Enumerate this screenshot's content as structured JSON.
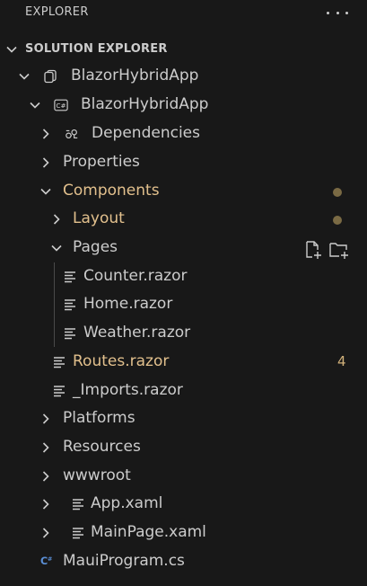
{
  "header": {
    "title": "EXPLORER",
    "more_icon": "ellipsis-icon"
  },
  "section": {
    "title": "SOLUTION EXPLORER",
    "expanded": true
  },
  "colors": {
    "background": "#181818",
    "text": "#cccccc",
    "modified": "#e2c08d",
    "badge": "#d1b17a",
    "csharp_icon": "#5b8fd6"
  },
  "tree": [
    {
      "label": "BlazorHybridApp",
      "chevron": "down",
      "icon": "solution-icon",
      "state": "normal"
    },
    {
      "label": "BlazorHybridApp",
      "chevron": "down",
      "icon": "csharp-project-icon",
      "state": "normal"
    },
    {
      "label": "Dependencies",
      "chevron": "right",
      "icon": "dependencies-icon",
      "state": "normal"
    },
    {
      "label": "Properties",
      "chevron": "right",
      "icon": "",
      "state": "normal"
    },
    {
      "label": "Components",
      "chevron": "down",
      "icon": "",
      "state": "modified",
      "indicator": "dot"
    },
    {
      "label": "Layout",
      "chevron": "right",
      "icon": "",
      "state": "modified",
      "indicator": "dot"
    },
    {
      "label": "Pages",
      "chevron": "down",
      "icon": "",
      "state": "normal",
      "actions": [
        "new-file-icon",
        "new-folder-icon"
      ]
    },
    {
      "label": "Counter.razor",
      "chevron": "",
      "icon": "file-lines-icon",
      "state": "normal"
    },
    {
      "label": "Home.razor",
      "chevron": "",
      "icon": "file-lines-icon",
      "state": "normal"
    },
    {
      "label": "Weather.razor",
      "chevron": "",
      "icon": "file-lines-icon",
      "state": "normal"
    },
    {
      "label": "Routes.razor",
      "chevron": "",
      "icon": "file-lines-icon",
      "state": "modified",
      "badge": "4"
    },
    {
      "label": "_Imports.razor",
      "chevron": "",
      "icon": "file-lines-icon",
      "state": "normal"
    },
    {
      "label": "Platforms",
      "chevron": "right",
      "icon": "",
      "state": "normal"
    },
    {
      "label": "Resources",
      "chevron": "right",
      "icon": "",
      "state": "normal"
    },
    {
      "label": "wwwroot",
      "chevron": "right",
      "icon": "",
      "state": "normal"
    },
    {
      "label": "App.xaml",
      "chevron": "right",
      "icon": "file-lines-icon",
      "state": "normal"
    },
    {
      "label": "MainPage.xaml",
      "chevron": "right",
      "icon": "file-lines-icon",
      "state": "normal"
    },
    {
      "label": "MauiProgram.cs",
      "chevron": "",
      "icon": "csharp-file-icon",
      "state": "normal"
    }
  ]
}
